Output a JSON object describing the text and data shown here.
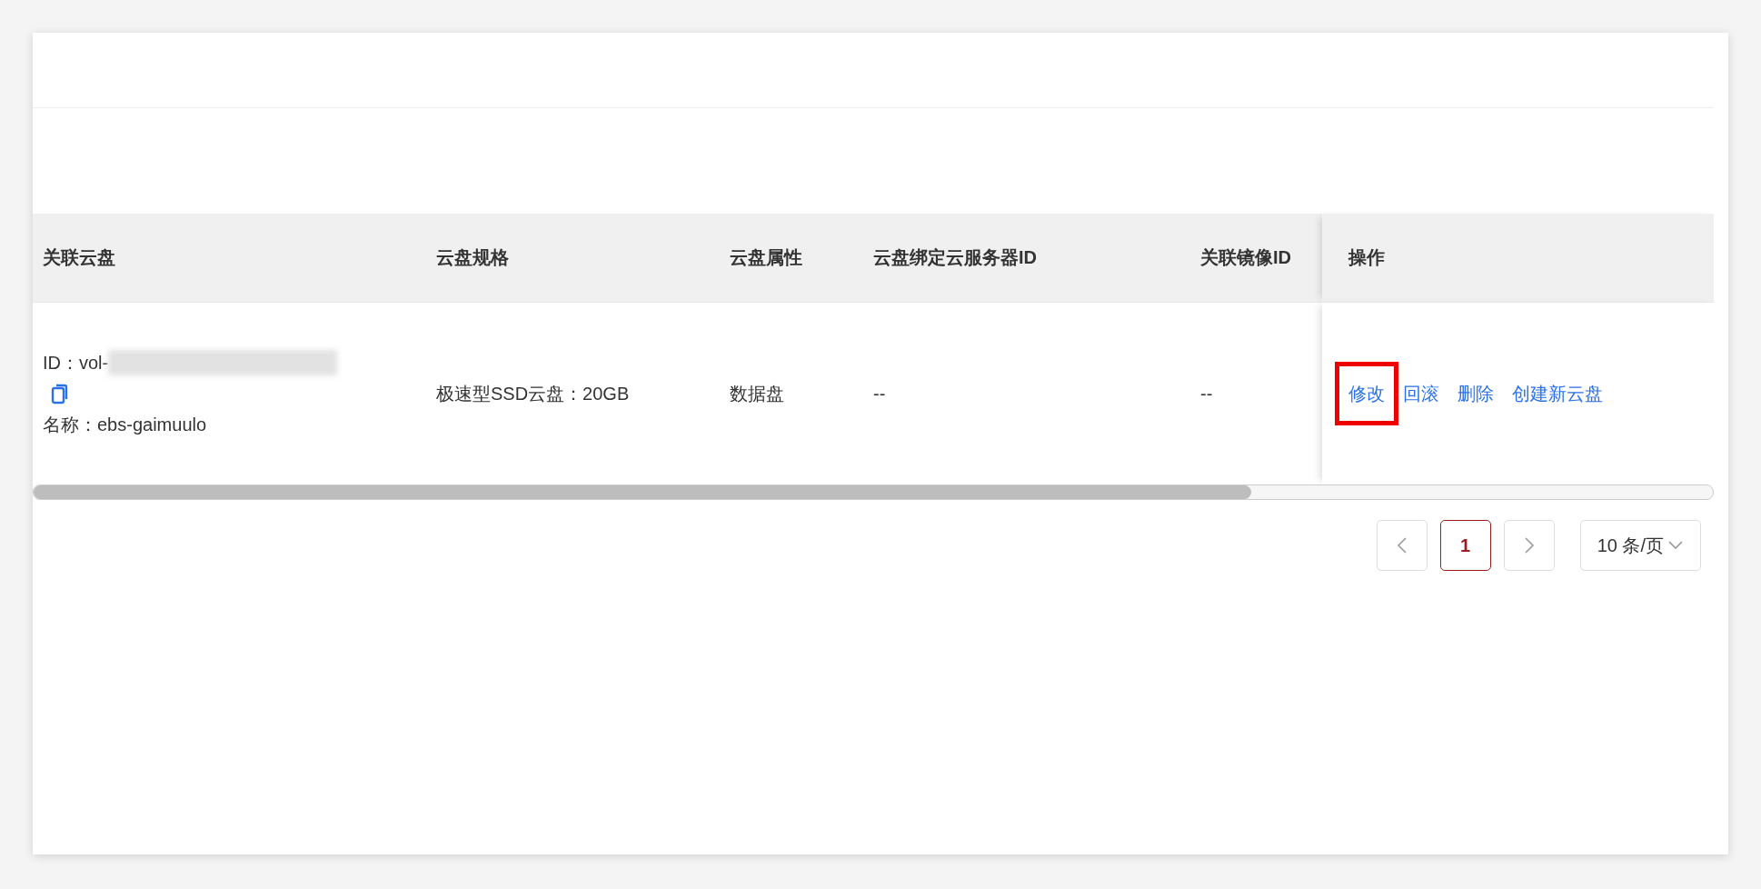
{
  "table": {
    "columns": [
      "关联云盘",
      "云盘规格",
      "云盘属性",
      "云盘绑定云服务器ID",
      "关联镜像ID",
      "操作"
    ],
    "rows": [
      {
        "disk_id_label": "ID：vol-",
        "disk_name": "名称：ebs-gaimuulo",
        "spec": "极速型SSD云盘：20GB",
        "attribute": "数据盘",
        "server_id": "--",
        "image_id": "--",
        "actions": [
          {
            "label": "修改",
            "highlighted": true
          },
          {
            "label": "回滚",
            "highlighted": false
          },
          {
            "label": "删除",
            "highlighted": false
          },
          {
            "label": "创建新云盘",
            "highlighted": false
          }
        ]
      }
    ]
  },
  "pagination": {
    "pages": [
      {
        "label": "1",
        "selected": true
      }
    ],
    "page_size": "10 条/页"
  }
}
